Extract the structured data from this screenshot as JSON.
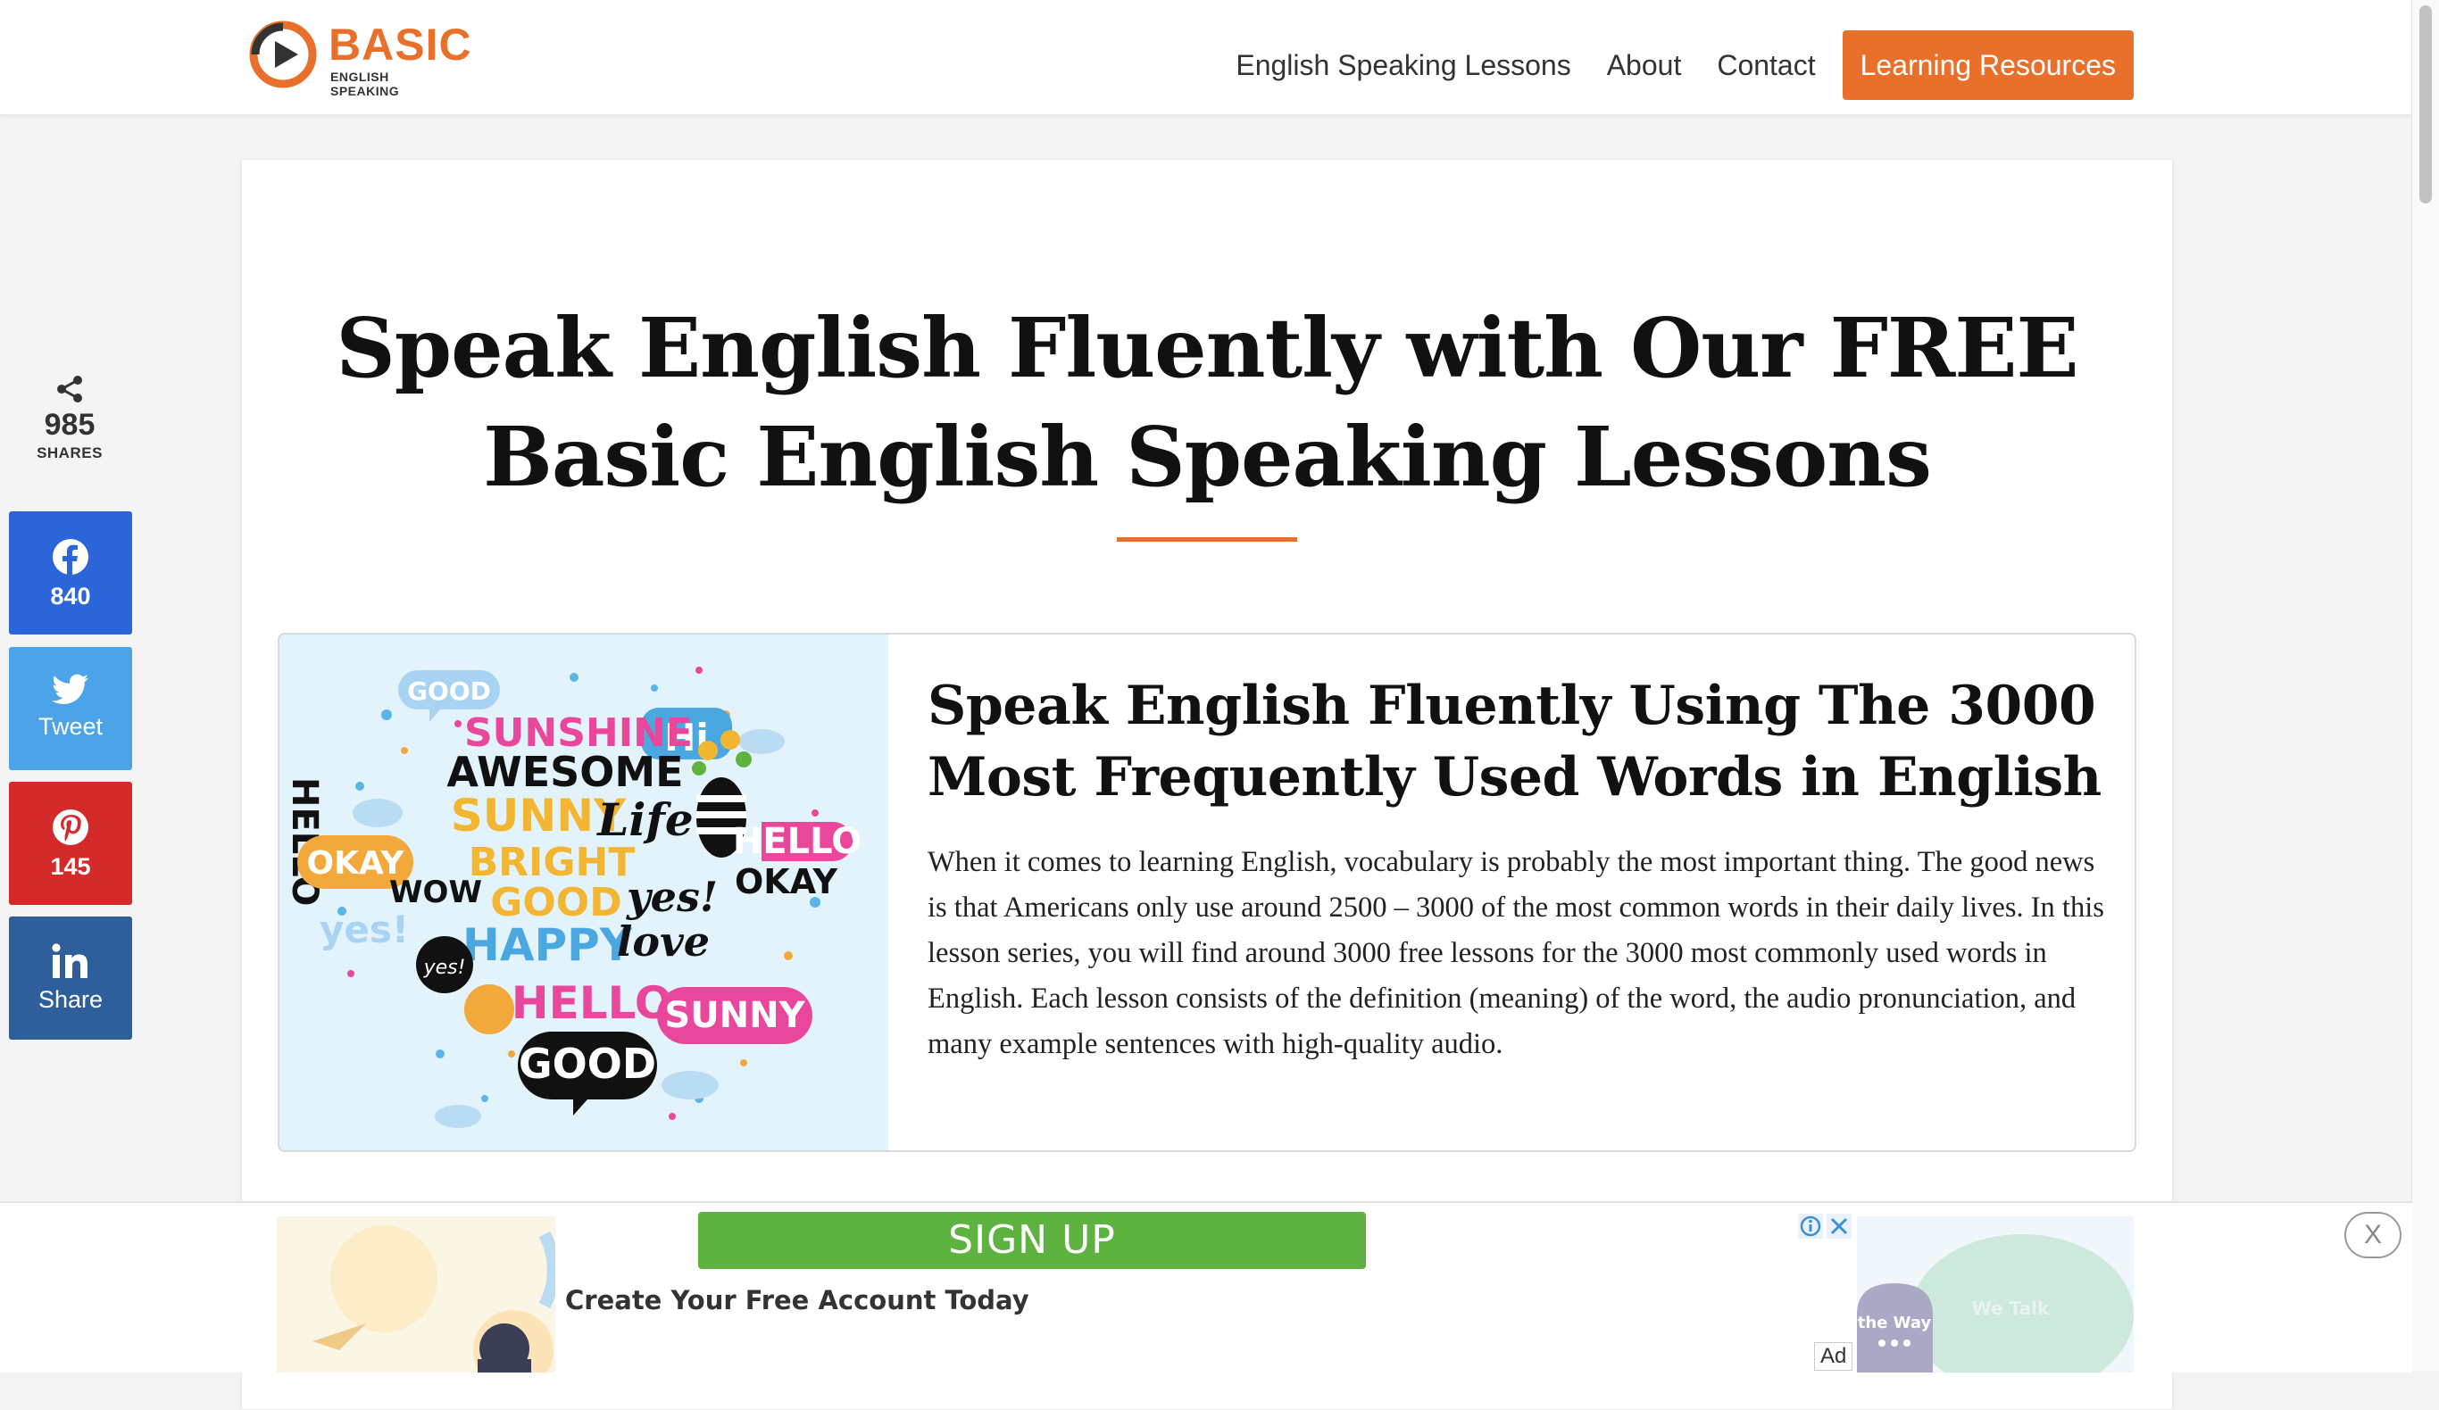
{
  "header": {
    "logo_main": "BASIC",
    "logo_sub": "ENGLISH SPEAKING",
    "nav": [
      {
        "label": "English Speaking Lessons"
      },
      {
        "label": "About"
      },
      {
        "label": "Contact"
      },
      {
        "label": "Learning Resources"
      }
    ]
  },
  "share": {
    "total_count": "985",
    "total_label": "SHARES",
    "facebook": "840",
    "twitter": "Tweet",
    "pinterest": "145",
    "linkedin": "Share"
  },
  "main": {
    "title": "Speak English Fluently with Our FREE Basic English Speaking Lessons",
    "lesson": {
      "title": "Speak English Fluently Using The 3000 Most Frequently Used Words in English",
      "description": "When it comes to learning English, vocabulary is probably the most important thing. The good news is that Americans only use around 2500 – 3000 of the most common words in their daily lives. In this lesson series, you will find around 3000 free lessons for the 3000 most commonly used words in English. Each lesson consists of the definition (meaning) of the word, the audio pronunciation, and many example sentences with high-quality audio.",
      "image_words": [
        "GOOD",
        "SUNSHINE",
        "Hi",
        "HELLO",
        "AWESOME",
        "SUNNY",
        "Life",
        "OKAY",
        "WOW",
        "BRIGHT",
        "GOOD",
        "yes!",
        "OKAY",
        "HELLO",
        "yes!",
        "HAPPY",
        "love",
        "yes!",
        "HELLO",
        "SUNNY",
        "GOOD"
      ]
    }
  },
  "ad": {
    "signup": "SIGN UP",
    "tagline": "Create Your Free Account Today",
    "label": "Ad",
    "close": "X",
    "thumb_right_text_1": "the Way",
    "thumb_right_text_2": "We Talk"
  },
  "colors": {
    "accent": "#e8702a",
    "facebook": "#2b65d9",
    "twitter": "#4ba3e8",
    "pinterest": "#d42a2a",
    "linkedin": "#2f5f9a",
    "signup": "#5eb340"
  }
}
